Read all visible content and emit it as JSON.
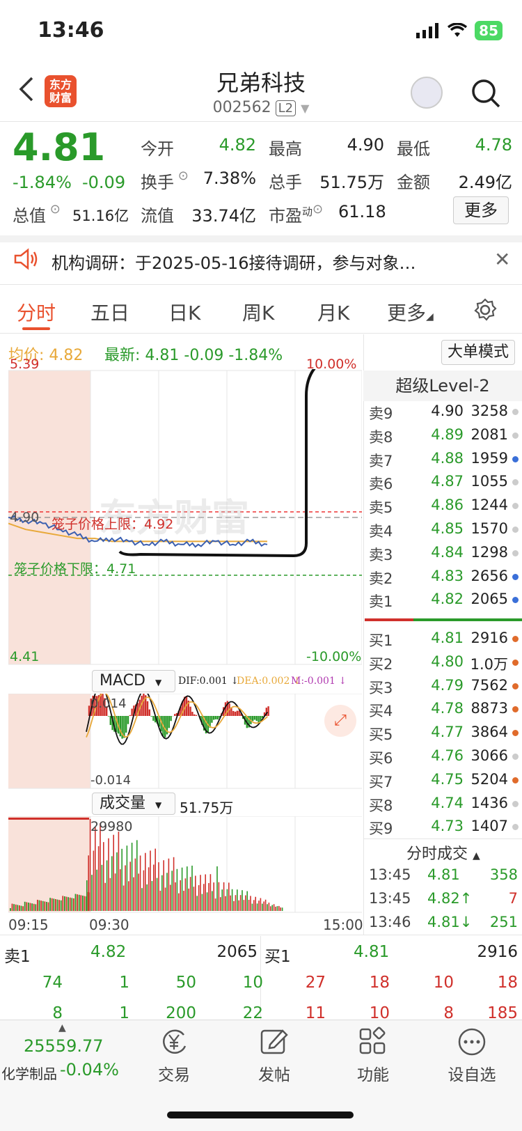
{
  "status_bar": {
    "time": "13:46",
    "battery": "85"
  },
  "header": {
    "title": "兄弟科技",
    "code": "002562",
    "level_badge": "L2",
    "logo_text_1": "东方",
    "logo_text_2": "财富"
  },
  "quote": {
    "price": "4.81",
    "change_pct": "-1.84%",
    "change": "-0.09",
    "open_label": "今开",
    "open": "4.82",
    "high_label": "最高",
    "high": "4.90",
    "low_label": "最低",
    "low": "4.78",
    "turnover_label": "换手",
    "turnover": "7.38%",
    "volume_label": "总手",
    "volume": "51.75万",
    "amount_label": "金额",
    "amount": "2.49亿",
    "mktcap_label": "总值",
    "mktcap": "51.16亿",
    "float_label": "流值",
    "float": "33.74亿",
    "pe_label": "市盈",
    "pe_sup": "动",
    "pe": "61.18",
    "more": "更多"
  },
  "notice": {
    "text": "机构调研：于2025-05-16接待调研，参与对象…"
  },
  "tabs": [
    "分时",
    "五日",
    "日K",
    "周K",
    "月K",
    "更多"
  ],
  "chart_header": {
    "avg_label": "均价:",
    "avg": "4.82",
    "latest_label": "最新:",
    "latest": "4.81",
    "chg": "-0.09",
    "chg_pct": "-1.84%",
    "big_order": "大单模式"
  },
  "chart": {
    "y_top": "5.39",
    "y_bottom": "4.41",
    "pct_top": "10.00%",
    "pct_bottom": "-10.00%",
    "ref_price": "4.90",
    "cage_upper": "笼子价格上限：4.92",
    "cage_lower": "笼子价格下限：4.71",
    "macd_label": "MACD",
    "dif": "DIF:0.001",
    "dea": "DEA:0.002",
    "m": "M:-0.001",
    "macd_top": "0.014",
    "macd_bottom": "-0.014",
    "vol_label": "成交量",
    "vol_total": "51.75万",
    "vol_max": "29980",
    "t_start": "09:15",
    "t_open": "09:30",
    "t_end": "15:00"
  },
  "chart_data": {
    "type": "line",
    "price_range": [
      4.41,
      5.39
    ],
    "series": [
      {
        "name": "最新",
        "values": [
          4.9,
          4.89,
          4.88,
          4.86,
          4.84,
          4.82,
          4.83,
          4.82,
          4.81,
          4.82,
          4.81,
          4.81,
          4.82,
          4.81,
          4.82,
          4.81
        ]
      },
      {
        "name": "均价",
        "values": [
          4.88,
          4.86,
          4.85,
          4.84,
          4.83,
          4.83,
          4.82,
          4.82,
          4.82,
          4.82,
          4.82,
          4.82,
          4.82,
          4.82,
          4.82,
          4.82
        ]
      }
    ]
  },
  "level2_title": "超级Level-2",
  "asks": [
    {
      "label": "卖9",
      "price": "4.90",
      "vol": "3258",
      "dot": "#cccccc",
      "pc": "dark"
    },
    {
      "label": "卖8",
      "price": "4.89",
      "vol": "2081",
      "dot": "#cccccc",
      "pc": "green"
    },
    {
      "label": "卖7",
      "price": "4.88",
      "vol": "1959",
      "dot": "#3a6fd8",
      "pc": "green"
    },
    {
      "label": "卖6",
      "price": "4.87",
      "vol": "1055",
      "dot": "#cccccc",
      "pc": "green"
    },
    {
      "label": "卖5",
      "price": "4.86",
      "vol": "1244",
      "dot": "#cccccc",
      "pc": "green"
    },
    {
      "label": "卖4",
      "price": "4.85",
      "vol": "1570",
      "dot": "#cccccc",
      "pc": "green"
    },
    {
      "label": "卖3",
      "price": "4.84",
      "vol": "1298",
      "dot": "#cccccc",
      "pc": "green"
    },
    {
      "label": "卖2",
      "price": "4.83",
      "vol": "2656",
      "dot": "#3a6fd8",
      "pc": "green"
    },
    {
      "label": "卖1",
      "price": "4.82",
      "vol": "2065",
      "dot": "#3a6fd8",
      "pc": "green"
    }
  ],
  "bids": [
    {
      "label": "买1",
      "price": "4.81",
      "vol": "2916",
      "dot": "#e06b2b",
      "pc": "green"
    },
    {
      "label": "买2",
      "price": "4.80",
      "vol": "1.0万",
      "dot": "#e06b2b",
      "pc": "green"
    },
    {
      "label": "买3",
      "price": "4.79",
      "vol": "7562",
      "dot": "#e06b2b",
      "pc": "green"
    },
    {
      "label": "买4",
      "price": "4.78",
      "vol": "8873",
      "dot": "#e06b2b",
      "pc": "green"
    },
    {
      "label": "买5",
      "price": "4.77",
      "vol": "3864",
      "dot": "#e06b2b",
      "pc": "green"
    },
    {
      "label": "买6",
      "price": "4.76",
      "vol": "3066",
      "dot": "#cccccc",
      "pc": "green"
    },
    {
      "label": "买7",
      "price": "4.75",
      "vol": "5204",
      "dot": "#e06b2b",
      "pc": "green"
    },
    {
      "label": "买8",
      "price": "4.74",
      "vol": "1436",
      "dot": "#cccccc",
      "pc": "green"
    },
    {
      "label": "买9",
      "price": "4.73",
      "vol": "1407",
      "dot": "#cccccc",
      "pc": "green"
    }
  ],
  "ticks_title": "分时成交",
  "ticks": [
    {
      "time": "13:45",
      "price": "4.81",
      "arrow": "",
      "vol": "358",
      "vc": "green"
    },
    {
      "time": "13:45",
      "price": "4.82",
      "arrow": "↑",
      "vol": "7",
      "vc": "red"
    },
    {
      "time": "13:46",
      "price": "4.81",
      "arrow": "↓",
      "vol": "251",
      "vc": "green"
    }
  ],
  "queue": {
    "sell_label": "卖1",
    "sell_price": "4.82",
    "sell_total": "2065",
    "buy_label": "买1",
    "buy_price": "4.81",
    "buy_total": "2916",
    "sell_row1": [
      "74",
      "1",
      "50",
      "10"
    ],
    "sell_row2": [
      "8",
      "1",
      "200",
      "22"
    ],
    "buy_row1": [
      "27",
      "18",
      "10",
      "18"
    ],
    "buy_row2": [
      "11",
      "10",
      "8",
      "185"
    ]
  },
  "bottom_bar": {
    "index_value": "25559.77",
    "index_name": "化学制品",
    "index_chg": "-0.04%",
    "trade": "交易",
    "post": "发帖",
    "func": "功能",
    "watch": "设自选"
  }
}
